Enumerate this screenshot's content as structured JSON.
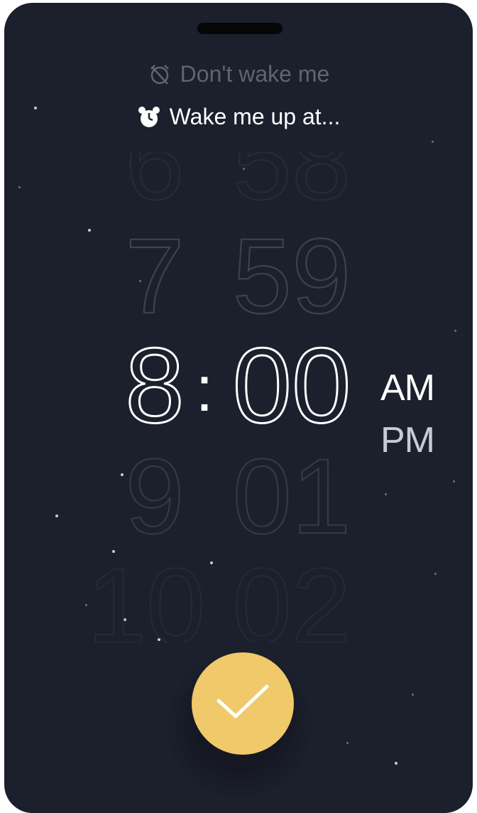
{
  "options": {
    "dont_wake_label": "Don't wake me",
    "wake_label": "Wake me up at...",
    "selected": "wake"
  },
  "picker": {
    "hours": [
      "6",
      "7",
      "8",
      "9",
      "10"
    ],
    "minutes": [
      "58",
      "59",
      "00",
      "01",
      "02"
    ],
    "selected_hour": "8",
    "selected_minute": "00",
    "separator": ":",
    "periods": [
      "AM",
      "PM"
    ],
    "selected_period": "AM"
  },
  "icons": {
    "dont_wake": "alarm-off-icon",
    "wake": "alarm-clock-icon",
    "confirm": "checkmark-icon"
  },
  "colors": {
    "background": "#1c202c",
    "accent": "#efc96a",
    "text_primary": "#ffffff",
    "text_muted": "#5f6472"
  }
}
